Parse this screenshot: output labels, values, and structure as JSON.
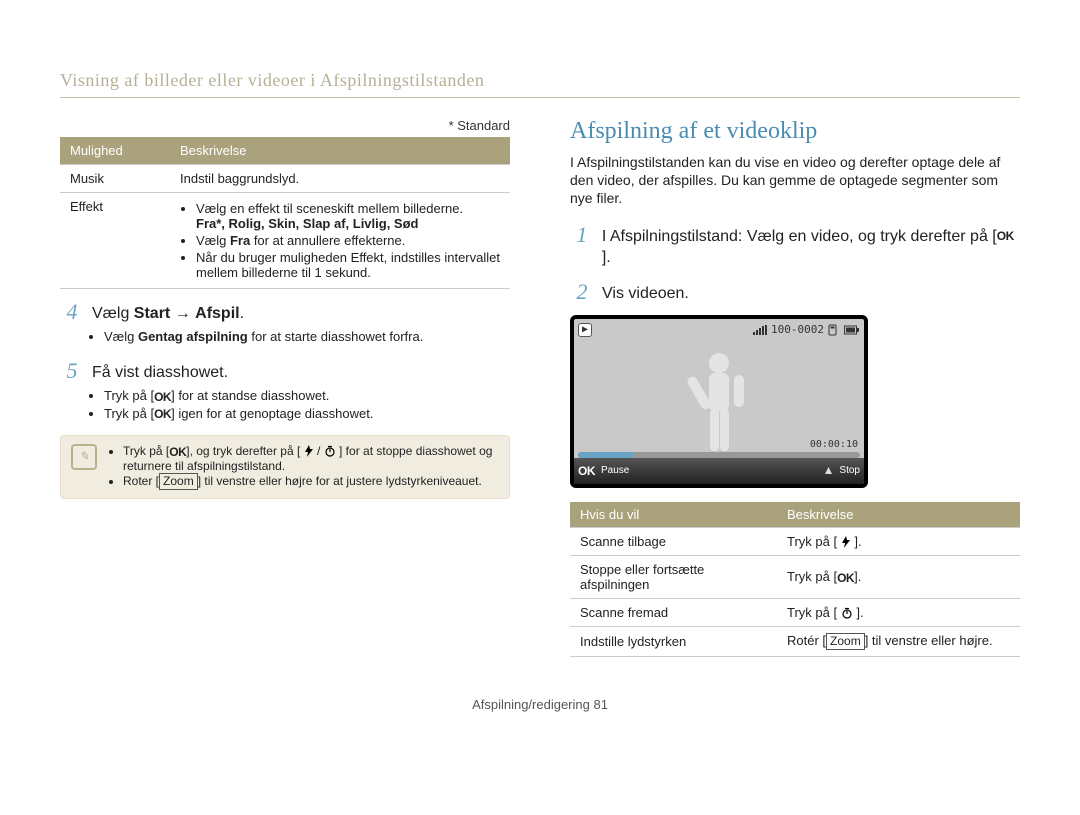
{
  "breadcrumb": "Visning af billeder eller videoer i Afspilningstilstanden",
  "standard_note": "* Standard",
  "opts_table": {
    "headers": [
      "Mulighed",
      "Beskrivelse"
    ],
    "rows": [
      {
        "opt": "Musik",
        "desc_plain": "Indstil baggrundslyd."
      },
      {
        "opt": "Effekt",
        "bullets": [
          "Vælg en effekt til sceneskift mellem billederne.",
          "Vælg Fra for at annullere effekterne.",
          "Når du bruger muligheden Effekt, indstilles intervallet mellem billederne til 1 sekund."
        ],
        "options_line_prefix": "",
        "options_bold": "Fra*, Rolig, Skin, Slap af, Livlig, Sød",
        "bullet2_prefix": "Vælg ",
        "bullet2_bold": "Fra",
        "bullet2_suffix": " for at annullere effekterne."
      }
    ]
  },
  "step4": {
    "num": "4",
    "prefix": "Vælg ",
    "bold": "Start",
    "arrow": " → ",
    "bold2": "Afspil",
    "suffix": ".",
    "sub": {
      "prefix": "Vælg ",
      "bold": "Gentag afspilning",
      "suffix": " for at starte diasshowet forfra."
    }
  },
  "step5": {
    "num": "5",
    "text": "Få vist diasshowet.",
    "bullet1_pre": "Tryk på [",
    "bullet1_ok": "OK",
    "bullet1_post": "] for at standse diasshowet.",
    "bullet2_pre": "Tryk på [",
    "bullet2_ok": "OK",
    "bullet2_post": "] igen for at genoptage diasshowet."
  },
  "notebox": {
    "icon": "✎",
    "items": [
      {
        "pre": "Tryk på [",
        "ok": "OK",
        "mid": "], og tryk derefter på [",
        "flash": "⚡",
        "slash": "/",
        "timer": "⏱",
        "post": "] for at stoppe diasshowet og returnere til afspilningstilstand."
      },
      {
        "pre": "Roter [",
        "zoom": "Zoom",
        "post": "] til venstre eller højre for at justere lydstyrkeniveauet."
      }
    ]
  },
  "right": {
    "heading": "Afspilning af et videoklip",
    "intro": "I Afspilningstilstanden kan du vise en video og derefter optage dele af den video, der afspilles. Du kan gemme de optagede segmenter som nye filer.",
    "step1": {
      "num": "1",
      "pre": "I Afspilningstilstand: Vælg en video, og tryk derefter på [",
      "ok": "OK",
      "post": "]."
    },
    "step2": {
      "num": "2",
      "text": "Vis videoen."
    },
    "preview": {
      "counter": "100-0002",
      "timecode": "00:00:10",
      "ok": "OK",
      "pause": "Pause",
      "stop": "Stop",
      "play_icon": "▶"
    },
    "actions": {
      "headers": [
        "Hvis du vil",
        "Beskrivelse"
      ],
      "rows": [
        {
          "label": "Scanne tilbage",
          "pre": "Tryk på [",
          "glyph": "flash",
          "post": "]."
        },
        {
          "label": "Stoppe eller fortsætte afspilningen",
          "pre": "Tryk på [",
          "glyph": "ok",
          "post": "]."
        },
        {
          "label": "Scanne fremad",
          "pre": "Tryk på [",
          "glyph": "timer",
          "post": "]."
        },
        {
          "label": "Indstille lydstyrken",
          "pre": "Rotér [",
          "glyph": "zoom",
          "post": "] til venstre eller højre."
        }
      ],
      "zoom_text": "Zoom",
      "ok_text": "OK"
    }
  },
  "footer": {
    "prefix": "Afspilning/redigering ",
    "page": "81"
  }
}
